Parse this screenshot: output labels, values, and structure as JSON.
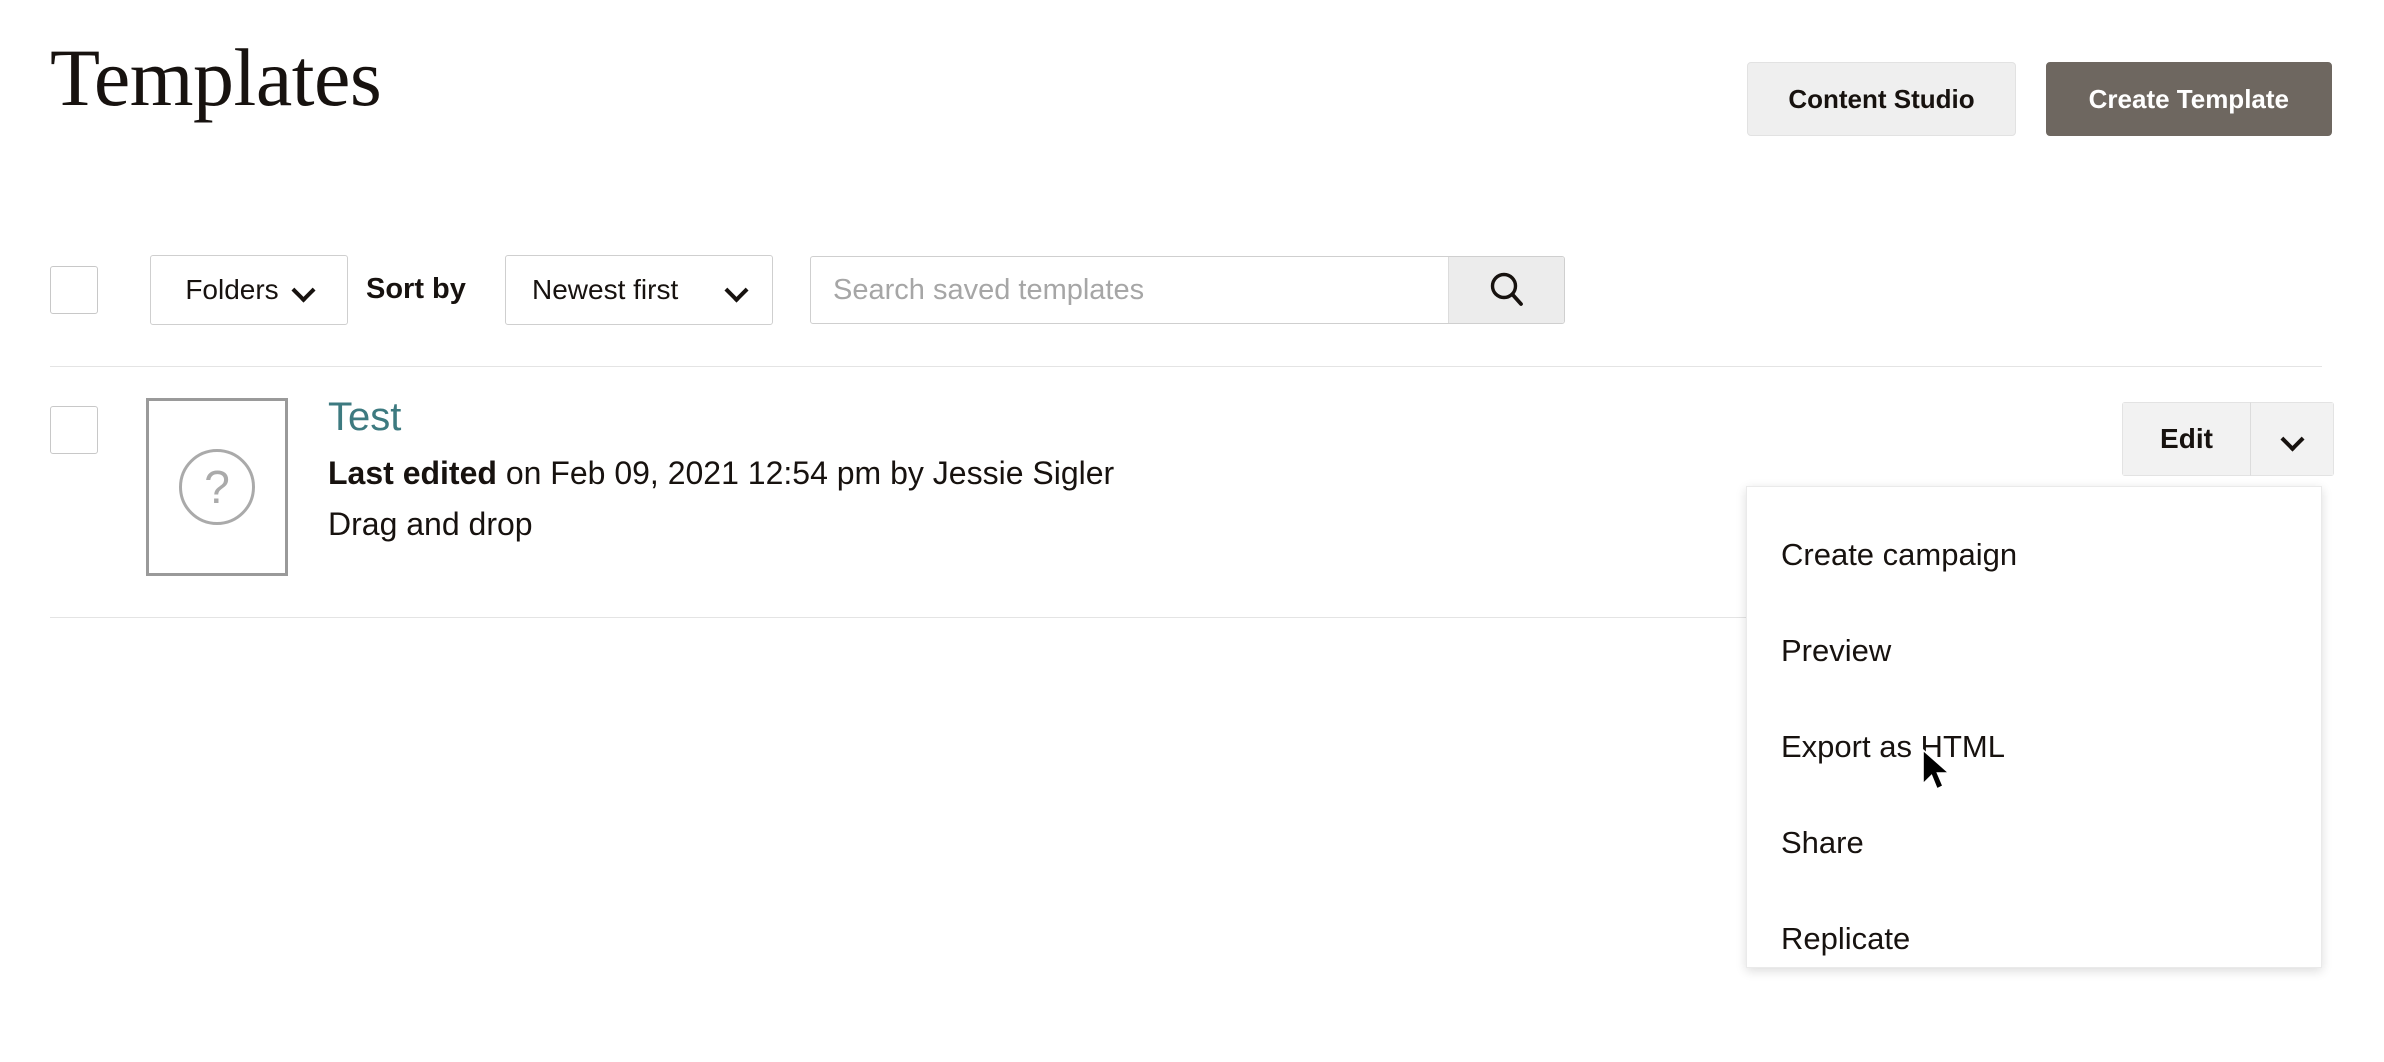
{
  "header": {
    "title": "Templates",
    "actions": [
      {
        "label": "Content Studio",
        "style": "secondary"
      },
      {
        "label": "Create Template",
        "style": "primary"
      }
    ]
  },
  "filter_bar": {
    "select_all_checkbox": "unchecked",
    "folders_label": "Folders",
    "sort_by_label": "Sort by",
    "sort_value": "Newest first",
    "search_placeholder": "Search saved templates",
    "search_value": "",
    "search_icon": "search-icon"
  },
  "templates": [
    {
      "checkbox": "unchecked",
      "thumbnail_icon": "question-mark-icon",
      "name": "Test",
      "meta_label": "Last edited",
      "meta_rest": " on Feb 09, 2021 12:54 pm by Jessie Sigler",
      "type": "Drag and drop",
      "edit_label": "Edit",
      "caret_icon": "chevron-down-icon"
    }
  ],
  "context_menu": {
    "open": true,
    "items": [
      {
        "label": "Create campaign"
      },
      {
        "label": "Preview"
      },
      {
        "label": "Export as HTML"
      },
      {
        "label": "Share"
      },
      {
        "label": "Replicate"
      }
    ]
  },
  "colors": {
    "primary_button": "#6e6760",
    "link": "#3d7a80",
    "secondary_button": "#efefef",
    "border": "#cfcfcf",
    "divider": "#e4e4e4"
  }
}
